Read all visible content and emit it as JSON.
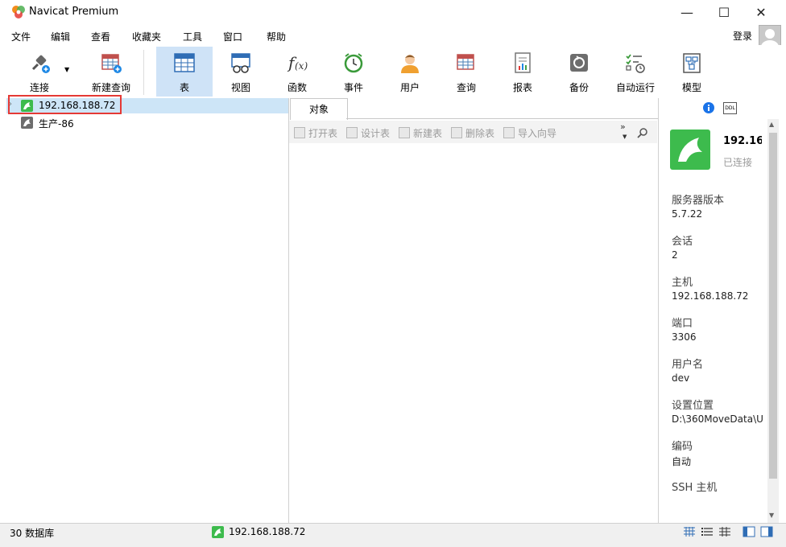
{
  "window": {
    "title": "Navicat Premium",
    "minimize": "—",
    "maximize": "☐",
    "close": "✕"
  },
  "menu": [
    "文件",
    "编辑",
    "查看",
    "收藏夹",
    "工具",
    "窗口",
    "帮助"
  ],
  "account": {
    "login": "登录"
  },
  "toolbar": {
    "connect": "连接",
    "new_query": "新建查询",
    "buttons": [
      "表",
      "视图",
      "函数",
      "事件",
      "用户",
      "查询",
      "报表",
      "备份",
      "自动运行",
      "模型"
    ],
    "active": "表"
  },
  "connections": [
    {
      "name": "192.168.188.72",
      "selected": true,
      "status": "connected"
    },
    {
      "name": "生产-86",
      "selected": false,
      "status": "disconnected"
    }
  ],
  "tabs": {
    "objects": "对象"
  },
  "object_toolbar": [
    "打开表",
    "设计表",
    "新建表",
    "删除表",
    "导入向导"
  ],
  "object_toolbar_more": "»",
  "info_panel": {
    "conn_title": "192.16",
    "conn_status": "已连接",
    "fields": [
      {
        "label": "服务器版本",
        "value": "5.7.22"
      },
      {
        "label": "会话",
        "value": "2"
      },
      {
        "label": "主机",
        "value": "192.168.188.72"
      },
      {
        "label": "端口",
        "value": "3306"
      },
      {
        "label": "用户名",
        "value": "dev"
      },
      {
        "label": "设置位置",
        "value": "D:\\360MoveData\\U"
      },
      {
        "label": "编码",
        "value": "自动"
      },
      {
        "label": "SSH 主机",
        "value": ""
      }
    ]
  },
  "status": {
    "count": "30 数据库",
    "connection": "192.168.188.72"
  },
  "colors": {
    "accent": "#cfe3f7",
    "mysql_green": "#3dbb4d",
    "highlight_box": "#e53935",
    "info_blue": "#1a73e8"
  }
}
